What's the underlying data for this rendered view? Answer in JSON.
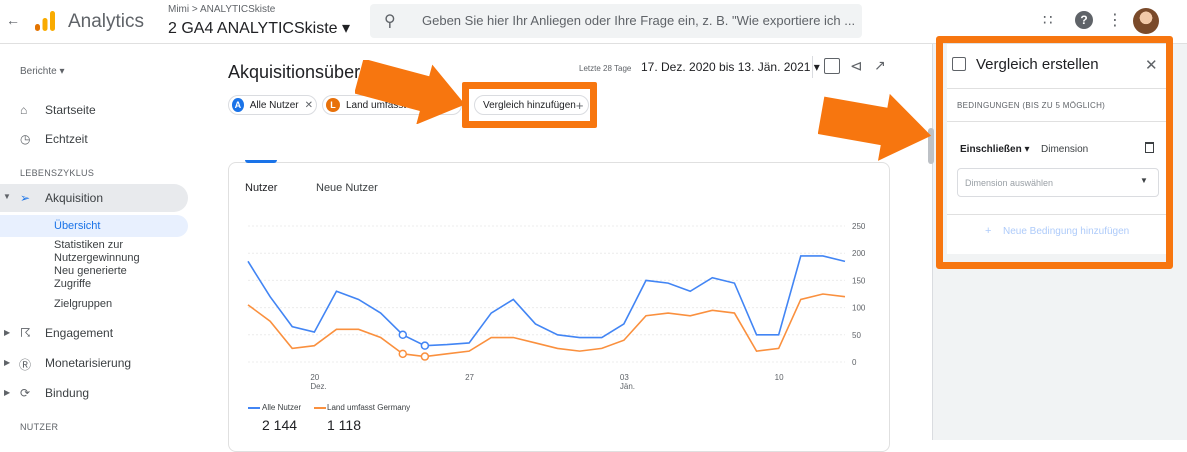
{
  "topbar": {
    "back_glyph": "←",
    "app_name": "Analytics",
    "account_crumb": "Mimi > ANALYTICSkiste",
    "property_name": "2 GA4 ANALYTICSkiste ▾",
    "search_placeholder": "Geben Sie hier Ihr Anliegen oder Ihre Frage ein, z. B. \"Wie exportiere ich ...",
    "icons": [
      "arrow-back-icon",
      "analytics-logo",
      "search-icon",
      "apps-grid-icon",
      "help-icon",
      "more-vert-icon",
      "avatar"
    ],
    "colors": {
      "logo_orange": "#f9ab00",
      "logo_dark": "#e37400"
    }
  },
  "sidebar": {
    "reports_label": "Berichte ▾",
    "items": [
      {
        "label": "Startseite",
        "icon": "home-icon"
      },
      {
        "label": "Echtzeit",
        "icon": "clock-icon"
      }
    ],
    "lifecycle_head": "LEBENSZYKLUS",
    "acquisition": {
      "label": "Akquisition",
      "icon": "acquisition-icon"
    },
    "acq_sub": [
      "Übersicht",
      "Statistiken zur Nutzergewinnung",
      "Neu generierte Zugriffe",
      "Zielgruppen"
    ],
    "acq_sub_lines": {
      "stat1": "Statistiken zur",
      "stat2": "Nutzergewinnung",
      "neu1": "Neu generierte",
      "neu2": "Zugriffe"
    },
    "engagement": {
      "label": "Engagement",
      "icon": "engagement-icon"
    },
    "monetization": {
      "label": "Monetarisierung",
      "icon": "dollar-icon"
    },
    "retention": {
      "label": "Bindung",
      "icon": "retention-icon"
    },
    "users_head": "NUTZER",
    "active_color": "#1a73e8"
  },
  "main": {
    "title": "Akquisitionsübers",
    "date_label": "Letzte 28 Tage",
    "date_range": "17. Dez. 2020 bis 13. Jän. 2021 ▾",
    "chips": [
      {
        "badge": "A",
        "label": "Alle Nutzer",
        "color": "#1a73e8"
      },
      {
        "badge": "L",
        "label": "Land umfasst Germ",
        "color": "#e8710a"
      }
    ],
    "add_comparison": "Vergleich hinzufügen",
    "tabs": [
      "Nutzer",
      "Neue Nutzer"
    ]
  },
  "chart_data": {
    "type": "line",
    "x_tick_labels": [
      "20\nDez.",
      "27",
      "03\nJän.",
      "10"
    ],
    "x_ticks": [
      {
        "d": 20,
        "label": "20",
        "sub": "Dez."
      },
      {
        "d": 27,
        "label": "27",
        "sub": ""
      },
      {
        "d": 34,
        "label": "03",
        "sub": "Jän."
      },
      {
        "d": 41,
        "label": "10",
        "sub": ""
      }
    ],
    "y_ticks": [
      0,
      50,
      100,
      150,
      200,
      250
    ],
    "ylim": [
      0,
      250
    ],
    "x": [
      17,
      18,
      19,
      20,
      21,
      22,
      23,
      24,
      25,
      26,
      27,
      28,
      29,
      30,
      31,
      32,
      33,
      34,
      35,
      36,
      37,
      38,
      39,
      40,
      41,
      42,
      43,
      44
    ],
    "series": [
      {
        "name": "Alle Nutzer",
        "color": "#4285f4",
        "values": [
          185,
          120,
          65,
          55,
          130,
          115,
          90,
          50,
          30,
          32,
          35,
          90,
          115,
          70,
          50,
          45,
          45,
          70,
          150,
          145,
          130,
          155,
          145,
          50,
          50,
          195,
          195,
          185
        ]
      },
      {
        "name": "Land umfasst Germany",
        "color": "#fa903e",
        "values": [
          105,
          75,
          25,
          30,
          60,
          60,
          45,
          15,
          10,
          15,
          20,
          45,
          45,
          35,
          25,
          20,
          25,
          40,
          85,
          90,
          85,
          95,
          90,
          20,
          25,
          115,
          125,
          120
        ]
      }
    ],
    "legend": [
      {
        "name": "Alle Nutzer",
        "color": "#4285f4"
      },
      {
        "name": "Land umfasst Germany",
        "color": "#fa903e"
      }
    ],
    "totals": [
      "2 144",
      "1 118"
    ],
    "markers": [
      {
        "series": 0,
        "x": 24
      },
      {
        "series": 0,
        "x": 25
      },
      {
        "series": 1,
        "x": 24
      },
      {
        "series": 1,
        "x": 25
      }
    ]
  },
  "panel": {
    "title": "Vergleich erstellen",
    "conditions_head": "BEDINGUNGEN (BIS ZU 5 MÖGLICH)",
    "include": "Einschließen ▾",
    "dimension": "Dimension",
    "select_placeholder": "Dimension auswählen",
    "add_condition": "Neue Bedingung hinzufügen",
    "highlight_color": "#f7760f"
  }
}
